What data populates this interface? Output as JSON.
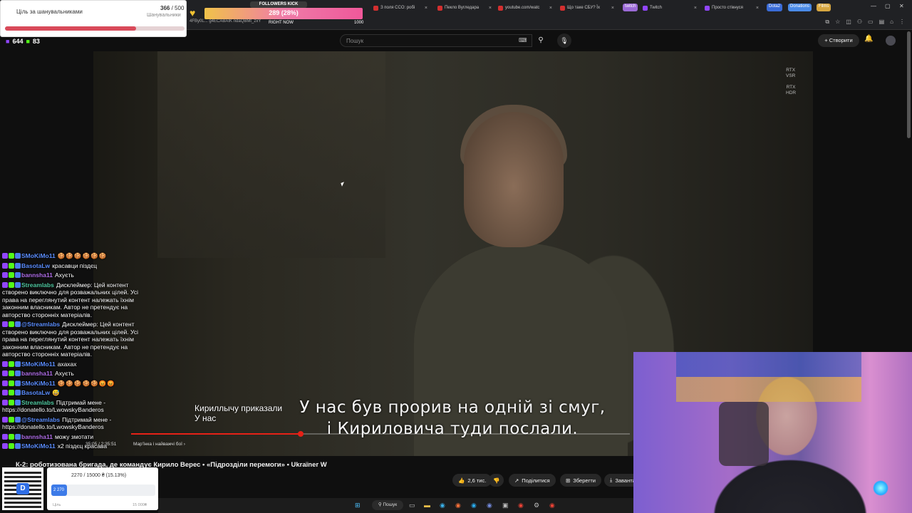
{
  "browser": {
    "tabs": [
      {
        "label": "З поля CCO: робі",
        "color": "#d32f2f"
      },
      {
        "label": "Пекло Вугледара",
        "color": "#d32f2f"
      },
      {
        "label": "youtube.com/watc",
        "color": "#d32f2f"
      },
      {
        "label": "Що таке СБУ? Їх",
        "color": "#d32f2f"
      },
      {
        "label": "Twitch",
        "color": "#9146ff"
      },
      {
        "label": "Просто стікнуся",
        "color": "#9146ff"
      }
    ],
    "pills": [
      "twitch",
      "Dota2",
      "Donations",
      "Films"
    ],
    "url": "4FBy0L... g4ECABAIK ndaQBMt_zxY",
    "window_controls": {
      "min": "—",
      "max": "▢",
      "close": "✕"
    }
  },
  "youtube": {
    "search_placeholder": "Пошук",
    "create_label": "Створити",
    "rtx": [
      [
        "RTX",
        "VSR"
      ],
      [
        "RTX",
        "HDR"
      ]
    ],
    "subtitle_lines": [
      "У нас був прорив на одній зі смуг,",
      "і Кириловича туди послали."
    ],
    "auto_caption_lines": [
      "Кириллычу приказали",
      "У нас"
    ],
    "time": "35:05 / 2:35:51",
    "chapter": "Мар'їнка і найважчі бої  ›",
    "progress": 0.34,
    "title": "К-2: роботизована бригада, де командує Кирило Верес • «Підрозділи перемоги» • Ukraïner W",
    "actions": {
      "likes": "2,6 тис.",
      "share": "Поділитися",
      "save": "Зберегти",
      "download": "Завантажити"
    }
  },
  "overlay": {
    "goal": {
      "label": "Ціль за шанувальниками",
      "count": "366",
      "total": "/ 500",
      "unit": "Шанувальники",
      "fraction": 0.732
    },
    "followers_kick": {
      "title": "FOLLOWERS KICK",
      "value": "289 (28%)",
      "right_now": "RIGHT NOW",
      "max": "1000"
    },
    "viewers": {
      "a": "644",
      "b": "83"
    },
    "donation": {
      "text": "2270 / 15000 ₴ (15.13%)",
      "bar_label": "2 270",
      "min": "Ціль",
      "max": "15 000₴",
      "fraction": 0.1513
    }
  },
  "chat": [
    {
      "nick": "SMoKiMo11",
      "color": "#5b8dfe",
      "text": "",
      "emotes": "🍪🍪🍪🍪🍪🍪"
    },
    {
      "nick": "BasotaLw",
      "color": "#5b8dfe",
      "text": "красавци піздєц",
      "emotes": ""
    },
    {
      "nick": "bannsha11",
      "color": "#b06ee8",
      "text": "Ахуєть",
      "emotes": ""
    },
    {
      "nick": "Streamlabs",
      "color": "#50c8a0",
      "text": "Дисклеймер: Цей контент створено виключно для розважальних цілей. Усі права на переглянутий контент належать їхнім законним власникам. Автор не претендує на авторство сторонніх матеріалів.",
      "emotes": ""
    },
    {
      "nick": "@Streamlabs",
      "color": "#5b8dfe",
      "text": "Дисклеймер: Цей контент створено виключно для розважальних цілей. Усі права на переглянутий контент належать їхнім законним власникам. Автор не претендує на авторство сторонніх матеріалів.",
      "emotes": ""
    },
    {
      "nick": "SMoKiMo11",
      "color": "#5b8dfe",
      "text": "ахахах",
      "emotes": ""
    },
    {
      "nick": "bannsha11",
      "color": "#b06ee8",
      "text": "Ахуєть",
      "emotes": ""
    },
    {
      "nick": "SMoKiMo11",
      "color": "#5b8dfe",
      "text": "",
      "emotes": "🍪🍪🍪🍪🍪😡😡"
    },
    {
      "nick": "BasotaLw",
      "color": "#5b8dfe",
      "text": "",
      "emotes": "😅"
    },
    {
      "nick": "Streamlabs",
      "color": "#50c8a0",
      "text": "Підтримай мене - https://donatello.to/LwowskyBanderos",
      "emotes": ""
    },
    {
      "nick": "@Streamlabs",
      "color": "#5b8dfe",
      "text": "Підтримай мене - https://donatello.to/LwowskyBanderos",
      "emotes": ""
    },
    {
      "nick": "bannsha11",
      "color": "#b06ee8",
      "text": "можу змотати",
      "emotes": ""
    },
    {
      "nick": "SMoKiMo11",
      "color": "#5b8dfe",
      "text": "x2 піздєц красава",
      "emotes": ""
    }
  ],
  "taskbar": {
    "search": "Пошук"
  }
}
